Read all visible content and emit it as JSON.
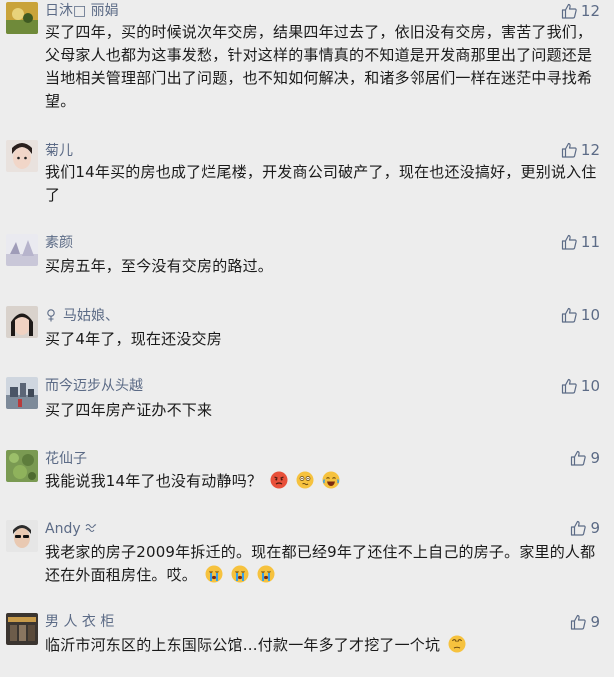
{
  "comments": [
    {
      "name": "日沐□ 丽娟",
      "likes": "12",
      "text": "买了四年，买的时候说次年交房，结果四年过去了，依旧没有交房，害苦了我们，父母家人也都为这事发愁，针对这样的事情真的不知道是开发商那里出了问题还是当地相关管理部门出了问题，也不知如何解决，和诸多邻居们一样在迷茫中寻找希望。"
    },
    {
      "name": "菊儿",
      "likes": "12",
      "text": "我们14年买的房也成了烂尾楼，开发商公司破产了，现在也还没搞好，更别说入住了"
    },
    {
      "name": "素颜",
      "likes": "11",
      "text": "买房五年，至今没有交房的路过。"
    },
    {
      "name": "马姑娘、",
      "likes": "10",
      "text": "买了4年了，现在还没交房"
    },
    {
      "name": "而今迈步从头越",
      "likes": "10",
      "text": "买了四年房产证办不下来"
    },
    {
      "name": "花仙子",
      "likes": "9",
      "text": "我能说我14年了也没有动静吗？"
    },
    {
      "name": "Andy",
      "likes": "9",
      "text": "我老家的房子2009年拆迁的。现在都已经9年了还住不上自己的房子。家里的人都还在外面租房住。哎。"
    },
    {
      "name": "男 人 衣 柜",
      "likes": "9",
      "text": "临沂市河东区的上东国际公馆…付款一年多了才挖了一个坑"
    }
  ],
  "colors": {
    "background": "#ededed",
    "name": "#5c6b86",
    "text": "#1a1a1a"
  },
  "icons": {
    "like": "thumbs-up-icon"
  }
}
